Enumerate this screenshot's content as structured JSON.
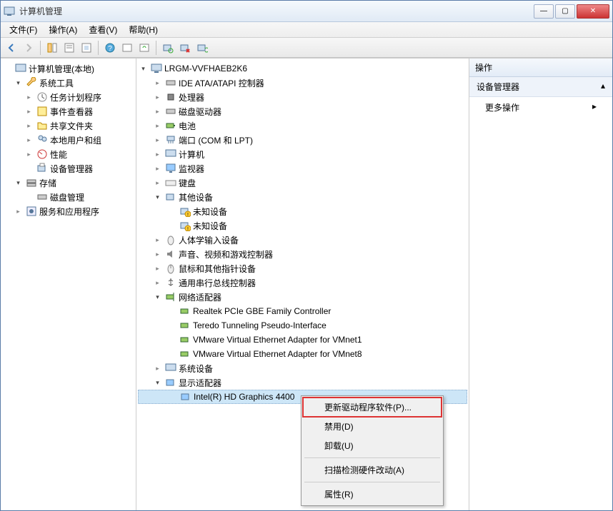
{
  "window": {
    "title": "计算机管理"
  },
  "menus": {
    "file": "文件(F)",
    "action": "操作(A)",
    "view": "查看(V)",
    "help": "帮助(H)"
  },
  "left_tree": {
    "root": "计算机管理(本地)",
    "sys_tools": "系统工具",
    "task_sched": "任务计划程序",
    "event_viewer": "事件查看器",
    "shared_folders": "共享文件夹",
    "local_users": "本地用户和组",
    "performance": "性能",
    "device_mgr": "设备管理器",
    "storage": "存储",
    "disk_mgmt": "磁盘管理",
    "services": "服务和应用程序"
  },
  "devices": {
    "computer": "LRGM-VVFHAEB2K6",
    "ide": "IDE ATA/ATAPI 控制器",
    "cpu": "处理器",
    "disk": "磁盘驱动器",
    "battery": "电池",
    "ports": "端口 (COM 和 LPT)",
    "pc": "计算机",
    "monitor": "监视器",
    "keyboard": "键盘",
    "other": "其他设备",
    "unknown1": "未知设备",
    "unknown2": "未知设备",
    "hid": "人体学输入设备",
    "sound": "声音、视频和游戏控制器",
    "mouse": "鼠标和其他指针设备",
    "usb": "通用串行总线控制器",
    "network": "网络适配器",
    "net1": "Realtek PCIe GBE Family Controller",
    "net2": "Teredo Tunneling Pseudo-Interface",
    "net3": "VMware Virtual Ethernet Adapter for VMnet1",
    "net4": "VMware Virtual Ethernet Adapter for VMnet8",
    "system": "系统设备",
    "display": "显示适配器",
    "gpu": "Intel(R) HD Graphics 4400"
  },
  "actions": {
    "header": "操作",
    "section": "设备管理器",
    "more": "更多操作"
  },
  "context_menu": {
    "update": "更新驱动程序软件(P)...",
    "disable": "禁用(D)",
    "uninstall": "卸载(U)",
    "scan": "扫描检测硬件改动(A)",
    "properties": "属性(R)"
  }
}
